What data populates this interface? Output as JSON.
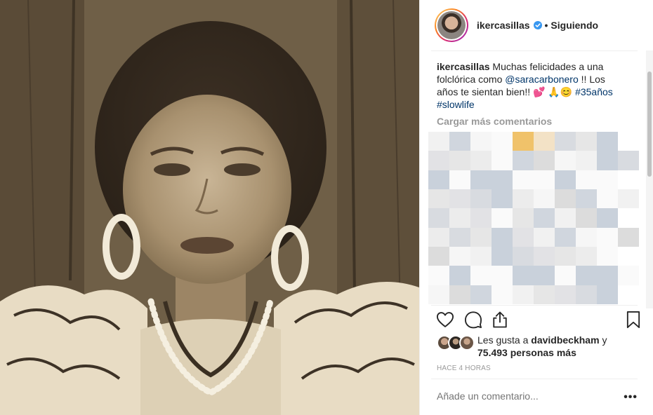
{
  "post": {
    "username": "ikercasillas",
    "follow_status": "Siguiendo",
    "dot": "•",
    "caption": {
      "username": "ikercasillas",
      "text_1": "Muchas felicidades a una folclórica como",
      "mention": "@saracarbonero",
      "text_2": "!! Los años te sientan bien!!",
      "emojis": "💕 🙏😊",
      "hashtag_1": "#35años",
      "hashtag_2": "#slowlife"
    },
    "load_more": "Cargar más comentarios",
    "likes": {
      "prefix": "Les gusta a",
      "liker": "davidbeckham",
      "connector": "y",
      "count_text": "75.493 personas más"
    },
    "time_ago": "HACE 4 HORAS",
    "comment_placeholder": "Añade un comentario...",
    "more_options": "•••"
  },
  "icons": {
    "verified": "verified-badge-icon",
    "like": "heart-icon",
    "comment": "comment-bubble-icon",
    "share": "share-icon",
    "save": "bookmark-icon",
    "more": "more-options-icon"
  },
  "colors": {
    "text": "#262626",
    "muted": "#999999",
    "link": "#003569",
    "verified": "#3897f0",
    "separator": "#efefef"
  }
}
